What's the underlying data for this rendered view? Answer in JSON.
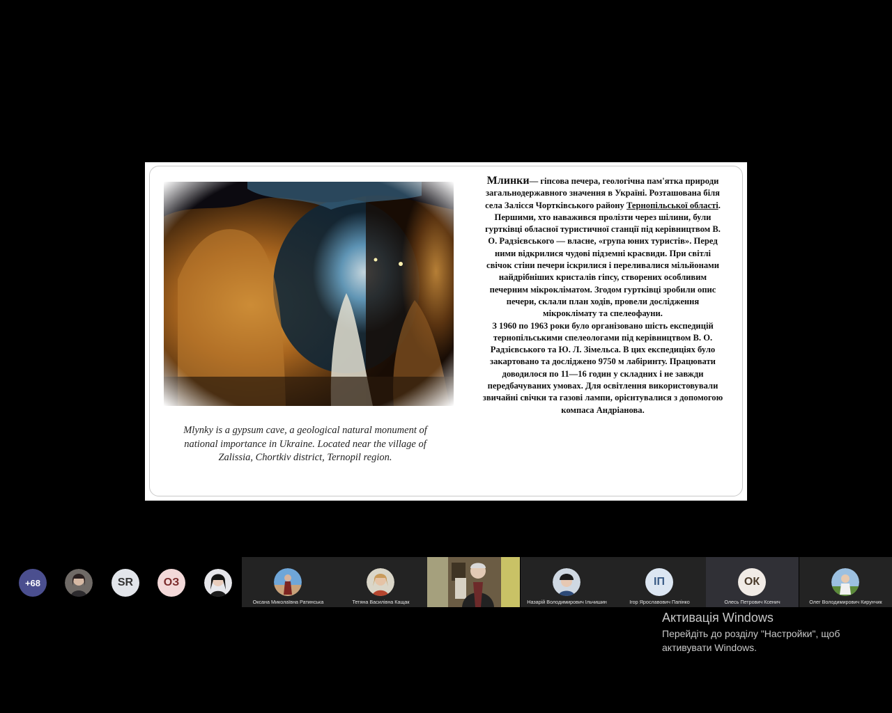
{
  "slide": {
    "caption_en": "Mlynky is a gypsum cave, a geological natural monument of national importance in Ukraine. Located near the village of Zalissia, Chortkiv district, Ternopil region.",
    "ua_title": "Млинки",
    "ua_intro": "— гіпсова печера, геологічна пам'ятка природи загальнодержавного значення в Україні. Розташована біля села Залісся Чортківського району ",
    "ua_link": "Тернопільської області",
    "ua_link_end": ".",
    "ua_p2": "Першими, хто наважився пролізти через шілини, були гуртківці обласної туристичної станції під керівництвом В. О. Радзієвського — власне, «група юних туристів». Перед ними відкрилися чудові підземні красвиди. При світлі свічок стіни печери іскрилися і переливалися мільйонами найдрібніших кристалів гіпсу, створених особливим печерним мікрокліматом. Згодом гуртківці зробили опис печери, склали план ходів, провели дослідження мікроклімату та спелеофауни.",
    "ua_p3": "З 1960 по 1963 роки було організовано шість експедицій тернопільськими спелеологами під керівництвом В. О. Радзієвського та Ю. Л. Зімельса. В цих експедиціях було закартовано та досліджено 9750 м лабіринту. Працювати доводилося по 11—16 годин у складних і не завжди передбачуваних умовах. Для освітлення використовували звичайні свічки та газові лампи, орієнтувалися з допомогою компаса Андріанова."
  },
  "participants": {
    "more_count": "+68",
    "initials_sr": "SR",
    "initials_oz": "ОЗ",
    "tiles": [
      {
        "name": "Оксана Миколаївна Ратинська"
      },
      {
        "name": "Тетяна Василівна Кащак"
      },
      {
        "name": ""
      },
      {
        "name": "Назарій Володимирович Ільчишин"
      },
      {
        "name": "Ігор Ярославович Папінко",
        "initials": "ІП"
      },
      {
        "name": "Олесь Петрович Ксенич",
        "initials": "ОК"
      },
      {
        "name": "Олег Володимирович Кирунчик"
      }
    ]
  },
  "watermark": {
    "title": "Активація Windows",
    "line1": "Перейдіть до розділу \"Настройки\", щоб",
    "line2": "активувати Windows."
  },
  "colors": {
    "background": "#000000",
    "more_badge": "#4b4f8f",
    "tile_bg": "#232323",
    "tile_active": "#303036"
  }
}
